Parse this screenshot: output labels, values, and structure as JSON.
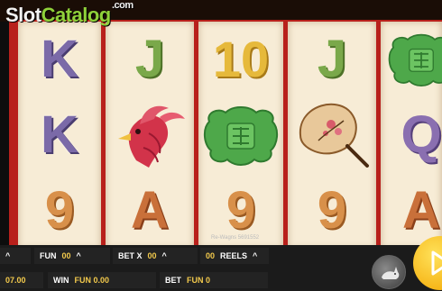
{
  "branding": {
    "logo_slot": "Slot",
    "logo_catalog": "Catalog",
    "logo_com": ".com"
  },
  "reels": [
    [
      "K",
      "K",
      "9"
    ],
    [
      "J",
      "phoenix",
      "A"
    ],
    [
      "10",
      "jade-medallion",
      "9"
    ],
    [
      "J",
      "fan",
      "9"
    ],
    [
      "jade-medallion",
      "Q",
      "A"
    ]
  ],
  "overlay": {
    "small_id": "Re-Wagns 5691552"
  },
  "controls": {
    "balance_partial": "07.00",
    "fun_label": "FUN",
    "fun_value": "00",
    "bet_x_label": "BET X",
    "bet_x_value": "00",
    "reels_value": "00",
    "reels_label": "REELS",
    "win_label": "WIN",
    "win_value": "FUN 0.00",
    "bet_label": "BET",
    "bet_value": "FUN 0",
    "arrow_up": "^",
    "left_partial": "0"
  },
  "colors": {
    "frame_red": "#b8201b",
    "reel_bg": "#f7ecd6",
    "value_gold": "#f2c94c",
    "logo_green": "#8fd13a"
  }
}
